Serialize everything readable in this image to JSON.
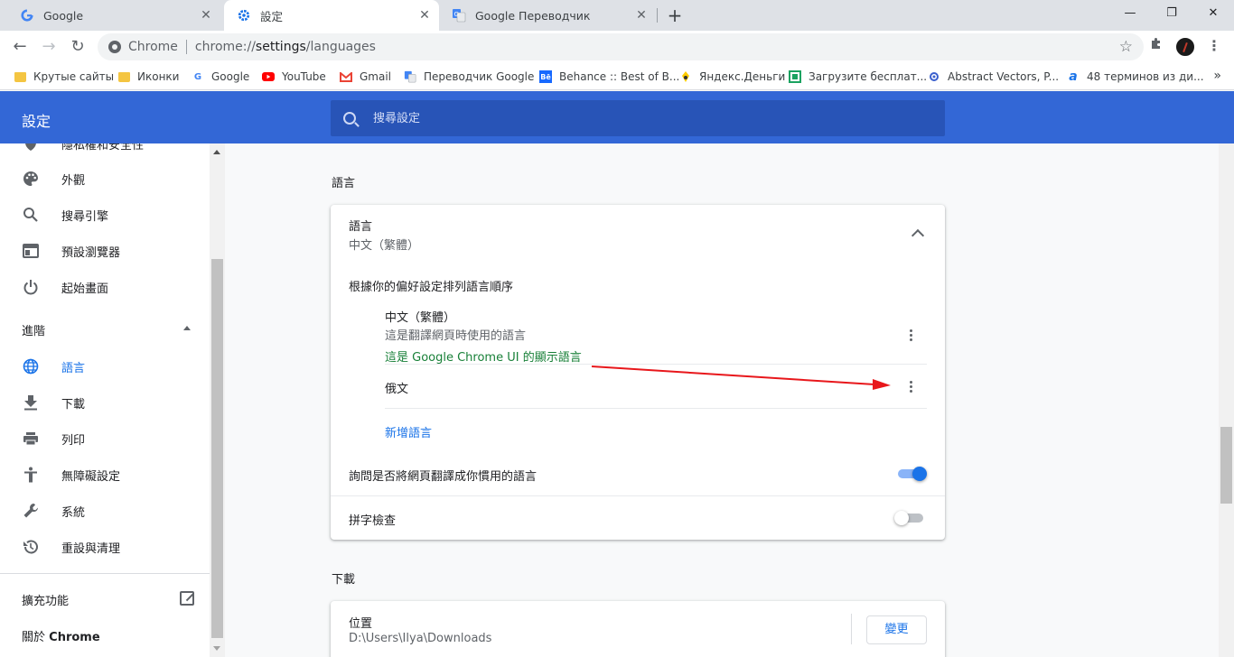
{
  "tabs": [
    {
      "title": "Google",
      "favicon": "google-icon"
    },
    {
      "title": "設定",
      "favicon": "settings-gear-icon"
    },
    {
      "title": "Google Переводчик",
      "favicon": "translate-icon"
    }
  ],
  "omnibox": {
    "label": "Chrome",
    "url_scheme": "chrome://",
    "url_host": "settings",
    "url_path": "/languages"
  },
  "bookmarks": [
    {
      "label": "Крутые сайты",
      "icon": "folder-icon"
    },
    {
      "label": "Иконки",
      "icon": "folder-icon"
    },
    {
      "label": "Google",
      "icon": "google-icon"
    },
    {
      "label": "YouTube",
      "icon": "youtube-icon"
    },
    {
      "label": "Gmail",
      "icon": "gmail-icon"
    },
    {
      "label": "Переводчик Google",
      "icon": "translate-icon"
    },
    {
      "label": "Behance :: Best of B...",
      "icon": "behance-icon"
    },
    {
      "label": "Яндекс.Деньги",
      "icon": "yandex-money-icon"
    },
    {
      "label": "Загрузите бесплат...",
      "icon": "download-site-icon"
    },
    {
      "label": "Abstract Vectors, P...",
      "icon": "abstract-vectors-icon"
    },
    {
      "label": "48 терминов из ди...",
      "icon": "a-letter-icon"
    }
  ],
  "header": {
    "title": "設定",
    "search_placeholder": "搜尋設定"
  },
  "sidebar": {
    "partial_item": "隱私權和安全性",
    "items": [
      {
        "label": "外觀",
        "icon": "palette-icon"
      },
      {
        "label": "搜尋引擎",
        "icon": "search-icon"
      },
      {
        "label": "預設瀏覽器",
        "icon": "browser-window-icon"
      },
      {
        "label": "起始畫面",
        "icon": "power-icon"
      }
    ],
    "advanced_label": "進階",
    "advanced_items": [
      {
        "label": "語言",
        "icon": "globe-icon",
        "active": true
      },
      {
        "label": "下載",
        "icon": "download-icon"
      },
      {
        "label": "列印",
        "icon": "printer-icon"
      },
      {
        "label": "無障礙設定",
        "icon": "accessibility-icon"
      },
      {
        "label": "系統",
        "icon": "wrench-icon"
      },
      {
        "label": "重設與清理",
        "icon": "restore-icon"
      }
    ],
    "extensions_label": "擴充功能",
    "about_prefix": "關於",
    "about_brand": "Chrome"
  },
  "languages_section": {
    "title": "語言",
    "card_title": "語言",
    "card_value": "中文（繁體）",
    "order_label": "根據你的偏好設定排列語言順序",
    "languages": [
      {
        "name": "中文（繁體）",
        "note": "這是翻譯網頁時使用的語言",
        "ui_note": "這是 Google Chrome UI 的顯示語言"
      },
      {
        "name": "俄文"
      }
    ],
    "add_language": "新增語言",
    "translate_prompt": "詢問是否將網頁翻譯成你慣用的語言",
    "translate_enabled": true,
    "spellcheck": "拼字檢查",
    "spellcheck_enabled": false
  },
  "downloads_section": {
    "title": "下載",
    "location_label": "位置",
    "location_value": "D:\\Users\\Ilya\\Downloads",
    "change_button": "變更"
  },
  "colors": {
    "accent": "#1a73e8",
    "header": "#3367d6",
    "annotation": "#e8171b"
  }
}
